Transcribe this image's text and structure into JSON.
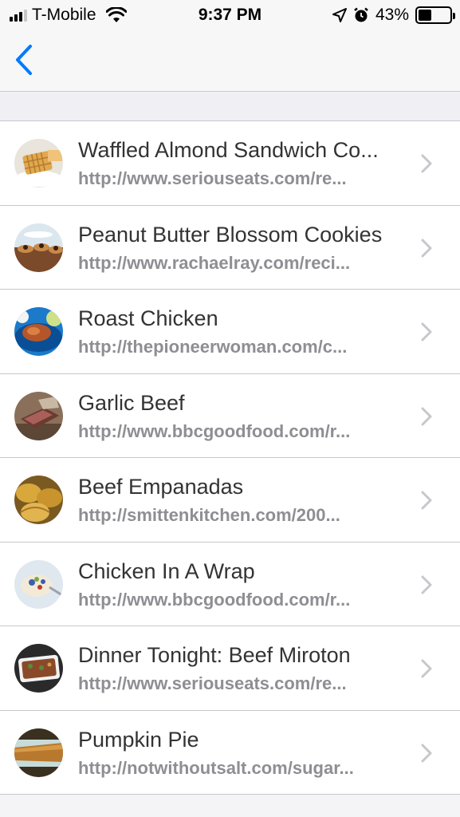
{
  "status_bar": {
    "carrier": "T-Mobile",
    "time": "9:37 PM",
    "battery": "43%",
    "battery_level": 0.43,
    "icons": [
      "signal-icon",
      "wifi-icon",
      "location-icon",
      "alarm-icon",
      "battery-icon"
    ]
  },
  "nav": {
    "back_icon": "chevron-left-icon",
    "accent_color": "#007aff"
  },
  "recipes": [
    {
      "title": "Waffled Almond Sandwich Co...",
      "url": "http://www.seriouseats.com/re...",
      "thumb": "waffle"
    },
    {
      "title": "Peanut Butter Blossom Cookies",
      "url": "http://www.rachaelray.com/reci...",
      "thumb": "cookies"
    },
    {
      "title": "Roast Chicken",
      "url": "http://thepioneerwoman.com/c...",
      "thumb": "chicken"
    },
    {
      "title": "Garlic Beef",
      "url": "http://www.bbcgoodfood.com/r...",
      "thumb": "beef"
    },
    {
      "title": "Beef Empanadas",
      "url": "http://smittenkitchen.com/200...",
      "thumb": "empanadas"
    },
    {
      "title": "Chicken In A Wrap",
      "url": "http://www.bbcgoodfood.com/r...",
      "thumb": "wrap"
    },
    {
      "title": "Dinner Tonight: Beef Miroton",
      "url": "http://www.seriouseats.com/re...",
      "thumb": "miroton"
    },
    {
      "title": "Pumpkin Pie",
      "url": "http://notwithoutsalt.com/sugar...",
      "thumb": "pie"
    }
  ]
}
